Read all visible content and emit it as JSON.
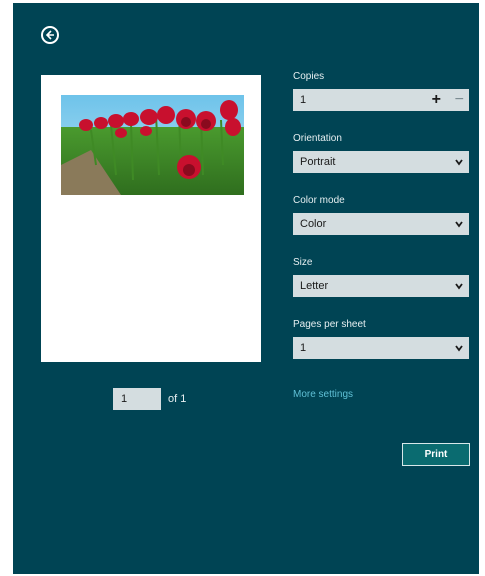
{
  "colors": {
    "background": "#004454",
    "field": "#d4dde0",
    "link": "#5fc0d6",
    "print_button": "#0a6b70"
  },
  "header": {
    "back_icon": "back-arrow-circle-icon"
  },
  "preview": {
    "image": "red-tulip-field-photo",
    "current_page": "1",
    "of_text": "of 1"
  },
  "settings": {
    "copies": {
      "label": "Copies",
      "value": "1",
      "increment_icon": "+",
      "decrement_icon": "−"
    },
    "orientation": {
      "label": "Orientation",
      "value": "Portrait"
    },
    "color_mode": {
      "label": "Color mode",
      "value": "Color"
    },
    "size": {
      "label": "Size",
      "value": "Letter"
    },
    "pages_per_sheet": {
      "label": "Pages per sheet",
      "value": "1"
    },
    "more_settings": "More settings"
  },
  "actions": {
    "print_label": "Print"
  }
}
